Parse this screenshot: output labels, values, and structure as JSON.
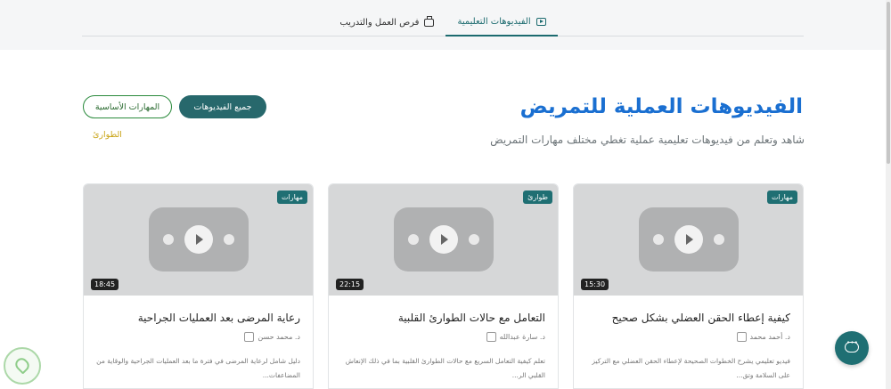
{
  "tabs": [
    {
      "label": "الفيديوهات التعليمية",
      "active": true
    },
    {
      "label": "فرص العمل والتدريب",
      "active": false
    }
  ],
  "page": {
    "title": "الفيديوهات العملية للتمريض",
    "subtitle": "شاهد وتعلم من فيديوهات تعليمية عملية تغطي مختلف مهارات التمريض"
  },
  "filters": {
    "all": "جميع الفيديوهات",
    "basic": "المهارات الأساسية",
    "emergency": "الطوارئ"
  },
  "videos": [
    {
      "category": "مهارات",
      "duration": "15:30",
      "title": "كيفية إعطاء الحقن العضلي بشكل صحيح",
      "author": "د. أحمد محمد",
      "description": "فيديو تعليمي يشرح الخطوات الصحيحة لإعطاء الحقن العضلي مع التركيز على السلامة وتق..."
    },
    {
      "category": "طوارئ",
      "duration": "22:15",
      "title": "التعامل مع حالات الطوارئ القلبية",
      "author": "د. سارة عبدالله",
      "description": "تعلم كيفية التعامل السريع مع حالات الطوارئ القلبية بما في ذلك الإنعاش القلبي الر..."
    },
    {
      "category": "مهارات",
      "duration": "18:45",
      "title": "رعاية المرضى بعد العمليات الجراحية",
      "author": "د. محمد حسن",
      "description": "دليل شامل لرعاية المرضى في فترة ما بعد العمليات الجراحية والوقاية من المضاعفات..."
    }
  ],
  "icons": {
    "tab_videos": "play-square-icon",
    "tab_jobs": "briefcase-icon",
    "author": "broken-image-icon",
    "chat": "chat-bubble-icon",
    "logo": "heart-logo-icon"
  },
  "colors": {
    "primary": "#1f6f73",
    "title": "#1a6fd1",
    "outline": "#2a8a3c",
    "accent": "#c9a416"
  }
}
